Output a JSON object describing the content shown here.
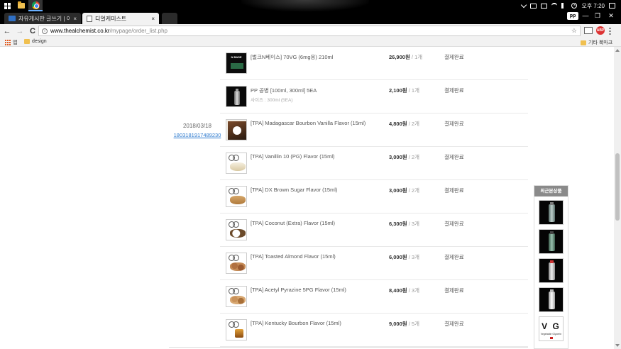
{
  "taskbar": {
    "clock": "오후 7:20",
    "tray_badge": "×"
  },
  "browser": {
    "tabs": [
      {
        "label": "자유게시판 글쓰기 | 이리",
        "close": "×"
      },
      {
        "label": "디얼케미스트",
        "close": "×"
      }
    ],
    "profile": "pp",
    "window_controls": {
      "minimize": "—",
      "restore": "❐",
      "close": "✕"
    },
    "nav": {
      "back": "←",
      "forward": "→",
      "reload": "C"
    },
    "url_host": "www.thealchemist.co.kr",
    "url_path": "/mypage/order_list.php",
    "star": "☆",
    "ext_abp": "ABP",
    "bookmarks": {
      "apps": "앱",
      "design": "design",
      "other": "기타 북마크"
    }
  },
  "order": {
    "date": "2018/03/18",
    "order_number": "1803181917489230",
    "items": [
      {
        "name": "[벌크N베이스] 70VG (6mg용) 210ml",
        "option": "",
        "price": "26,900원",
        "qty": " / 1개",
        "status": "결제완료",
        "thumb": "bulk"
      },
      {
        "name": "PP 공병 [100ml, 300ml] 5EA",
        "option": "사이즈 : 300ml (5EA)",
        "price": "2,100원",
        "qty": " / 1개",
        "status": "결제완료",
        "thumb": "bottle"
      },
      {
        "name": "[TPA] Madagascar Bourbon Vanilla Flavor (15ml)",
        "option": "",
        "price": "4,800원",
        "qty": " / 2개",
        "status": "결제완료",
        "thumb": "vanillabean"
      },
      {
        "name": "[TPA] Vanillin 10 (PG) Flavor (15ml)",
        "option": "",
        "price": "3,000원",
        "qty": " / 2개",
        "status": "결제완료",
        "thumb": "vanilla"
      },
      {
        "name": "[TPA] DX Brown Sugar Flavor (15ml)",
        "option": "",
        "price": "3,000원",
        "qty": " / 2개",
        "status": "결제완료",
        "thumb": "brown"
      },
      {
        "name": "[TPA] Coconut (Extra) Flavor (15ml)",
        "option": "",
        "price": "6,300원",
        "qty": " / 3개",
        "status": "결제완료",
        "thumb": "coconut"
      },
      {
        "name": "[TPA] Toasted Almond Flavor (15ml)",
        "option": "",
        "price": "6,000원",
        "qty": " / 3개",
        "status": "결제완료",
        "thumb": "almond"
      },
      {
        "name": "[TPA] Acetyl Pyrazine 5PG Flavor (15ml)",
        "option": "",
        "price": "8,400원",
        "qty": " / 3개",
        "status": "결제완료",
        "thumb": "pyrazine"
      },
      {
        "name": "[TPA] Kentucky Bourbon Flavor (15ml)",
        "option": "",
        "price": "9,000원",
        "qty": " / 5개",
        "status": "결제완료",
        "thumb": "bourbon"
      }
    ]
  },
  "recent_panel": {
    "title": "최근본상품",
    "vg_logo": "V G",
    "vg_sub": "Vegetable Glycerin"
  },
  "colors": {
    "link": "#2e7bcf",
    "panel_title_bg": "#8a8a8a"
  }
}
